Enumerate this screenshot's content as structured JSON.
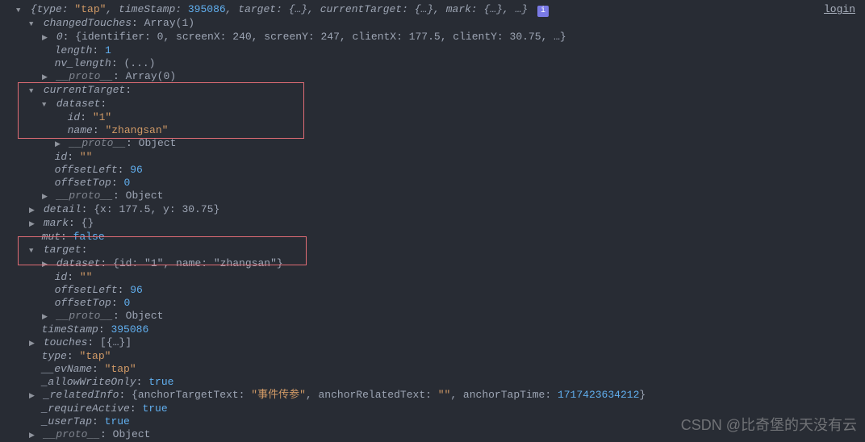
{
  "login": "login",
  "root": {
    "type": "\"tap\"",
    "timeStamp": "395086",
    "targetSummary": "{…}",
    "currentTargetSummary": "{…}",
    "markSummary": "{…}",
    "ellipsis": "…"
  },
  "changedTouches": {
    "label": "changedTouches",
    "summary": "Array(1)",
    "item0": "{identifier: 0, screenX: 240, screenY: 247, clientX: 177.5, clientY: 30.75, …}",
    "length": "1",
    "nv_length": "(...)",
    "proto": "Array(0)"
  },
  "currentTarget": {
    "label": "currentTarget",
    "dataset": {
      "label": "dataset",
      "id": "\"1\"",
      "name": "\"zhangsan\"",
      "proto": "Object"
    },
    "id": "\"\"",
    "offsetLeft": "96",
    "offsetTop": "0",
    "proto": "Object"
  },
  "detail": {
    "label": "detail",
    "summary": "{x: 177.5, y: 30.75}"
  },
  "mark": {
    "label": "mark",
    "summary": "{}"
  },
  "mut": "false",
  "target": {
    "label": "target",
    "datasetSummary": "{id: \"1\", name: \"zhangsan\"}",
    "id": "\"\"",
    "offsetLeft": "96",
    "offsetTop": "0",
    "proto": "Object"
  },
  "timeStamp": {
    "label": "timeStamp",
    "value": "395086"
  },
  "touches": {
    "label": "touches",
    "summary": "[{…}]"
  },
  "typeField": "\"tap\"",
  "evName": "\"tap\"",
  "allowWriteOnly": "true",
  "relatedInfo": {
    "label": "_relatedInfo",
    "anchorTargetText": "\"事件传参\"",
    "anchorRelatedText": "\"\"",
    "anchorTapTime": "1717423634212"
  },
  "requireActive": "true",
  "userTap": "true",
  "rootProto": "Object",
  "watermark": "CSDN @比奇堡的天没有云"
}
